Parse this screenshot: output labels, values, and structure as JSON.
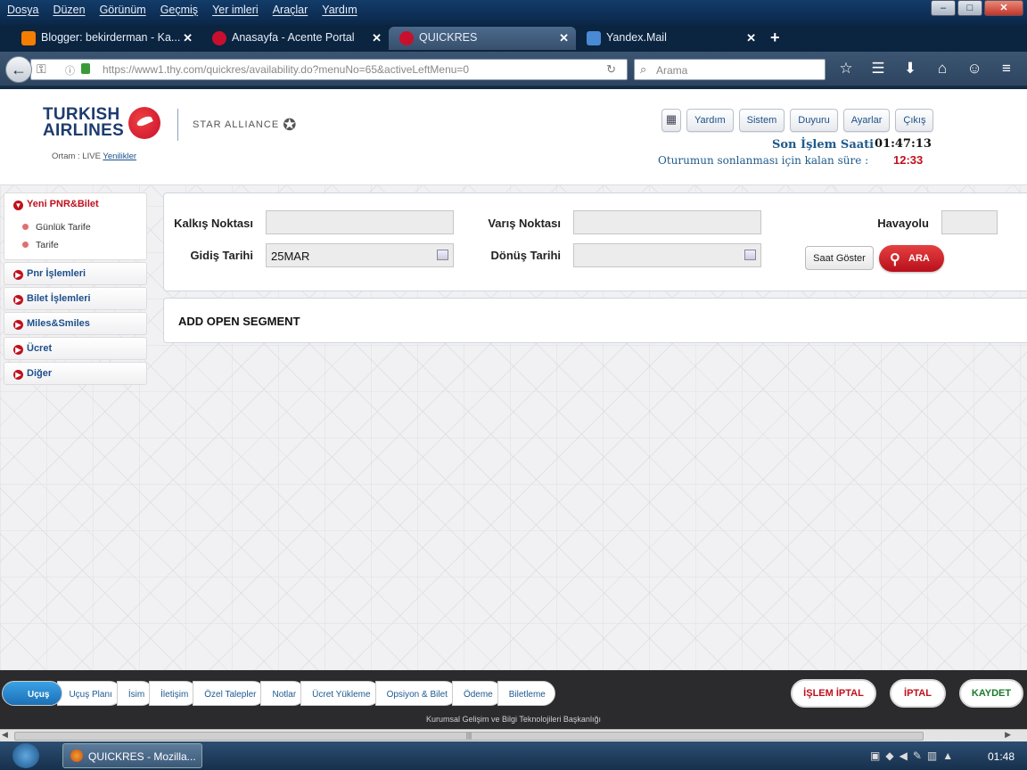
{
  "browser": {
    "menu": [
      "Dosya",
      "Düzen",
      "Görünüm",
      "Geçmiş",
      "Yer imleri",
      "Araçlar",
      "Yardım"
    ],
    "tabs": [
      {
        "title": "Blogger: bekirderman - Ka...",
        "icon": "blogger-icon",
        "color": "#f57d00"
      },
      {
        "title": "Anasayfa - Acente Portal",
        "icon": "thy-icon",
        "color": "#c8102e"
      },
      {
        "title": "QUICKRES",
        "icon": "thy-icon",
        "color": "#c8102e"
      },
      {
        "title": "Yandex.Mail",
        "icon": "mail-icon",
        "color": "#4a8ad4"
      }
    ],
    "url": "https://www1.thy.com/quickres/availability.do?menuNo=65&activeLeftMenu=0",
    "search_placeholder": "Arama",
    "window_controls": [
      "–",
      "□",
      "✕"
    ]
  },
  "header": {
    "logo_line1": "TURKISH",
    "logo_line2": "AIRLINES",
    "alliance": "STAR ALLIANCE",
    "env_label": "Ortam : LIVE",
    "env_link": "Yenilikler",
    "buttons": [
      "Yardım",
      "Sistem",
      "Duyuru",
      "Ayarlar",
      "Çıkış"
    ],
    "last_action_label": "Son İşlem Saati",
    "last_action_time": "01:47:13",
    "session_remaining_label": "Oturumun sonlanması için kalan süre :",
    "session_remaining": "12:33"
  },
  "sidebar": {
    "open_section": "Yeni PNR&Bilet",
    "sub_items": [
      "Günlük Tarife",
      "Tarife"
    ],
    "sections": [
      "Pnr İşlemleri",
      "Bilet İşlemleri",
      "Miles&Smiles",
      "Ücret",
      "Diğer"
    ]
  },
  "search": {
    "from_label": "Kalkış Noktası",
    "from_value": "",
    "to_label": "Varış Noktası",
    "to_value": "",
    "airline_label": "Havayolu",
    "airline_value": "",
    "depart_label": "Gidiş Tarihi",
    "depart_value": "25MAR",
    "return_label": "Dönüş Tarihi",
    "return_value": "",
    "show_time_button": "Saat Göster",
    "search_button": "ARA"
  },
  "open_segment": "ADD OPEN SEGMENT",
  "steps": [
    "Uçuş",
    "Uçuş Planı",
    "İsim",
    "İletişim",
    "Özel Talepler",
    "Notlar",
    "Ücret Yükleme",
    "Opsiyon & Bilet",
    "Ödeme",
    "Biletleme"
  ],
  "actions": {
    "cancel_transaction": "İŞLEM İPTAL",
    "cancel": "İPTAL",
    "save": "KAYDET"
  },
  "footer": "Kurumsal Gelişim ve Bilgi Teknolojileri Başkanlığı",
  "taskbar": {
    "item": "QUICKRES - Mozilla...",
    "clock": "01:48"
  },
  "colors": {
    "brand_red": "#c8102e",
    "brand_navy": "#1e3b6f",
    "link_blue": "#1d4f8a",
    "step_active": "#1c6fb6"
  }
}
